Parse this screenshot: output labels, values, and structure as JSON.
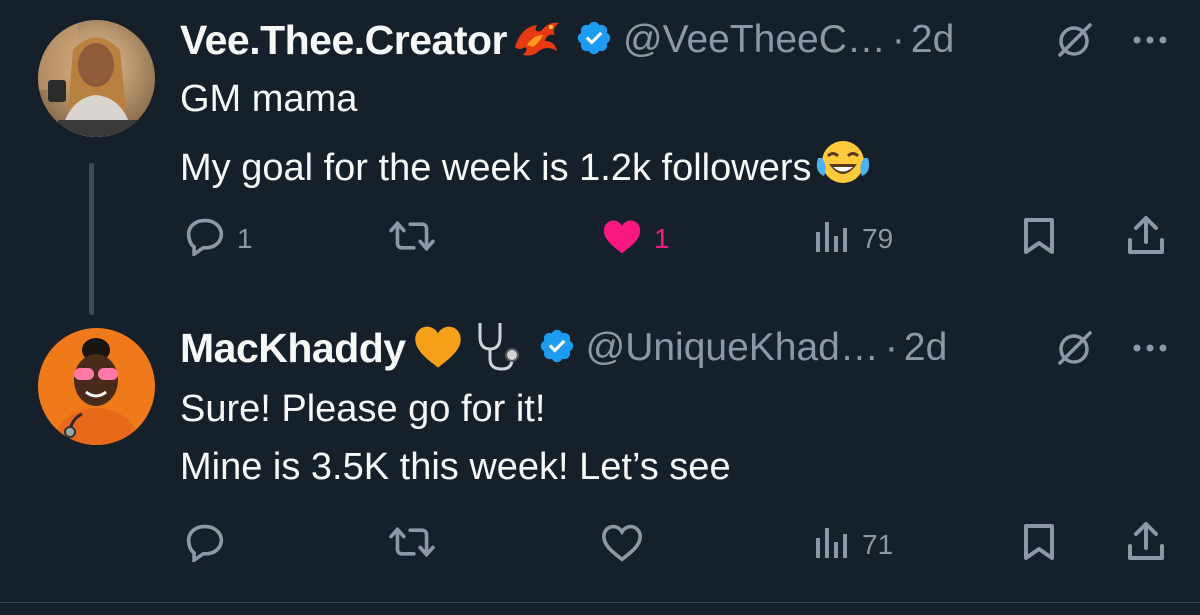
{
  "tweets": [
    {
      "name": "Vee.Thee.Creator",
      "handle": "@VeeTheeC…",
      "separator": "·",
      "time": "2d",
      "lines": [
        "GM mama",
        "My goal for the week is 1.2k followers"
      ],
      "name_emoji_icons": [
        "flame-bird-icon"
      ],
      "body_emoji_icon": "tears-of-joy-icon",
      "actions": {
        "reply_count": "1",
        "retweet_count": "",
        "like_count": "1",
        "liked": true,
        "views_count": "79"
      }
    },
    {
      "name": "MacKhaddy",
      "handle": "@UniqueKhad…",
      "separator": "·",
      "time": "2d",
      "lines": [
        "Sure! Please go for it!",
        "Mine is 3.5K this week! Let’s see"
      ],
      "name_emoji_icons": [
        "orange-heart-icon",
        "stethoscope-icon"
      ],
      "actions": {
        "reply_count": "",
        "retweet_count": "",
        "like_count": "",
        "liked": false,
        "views_count": "71"
      }
    }
  ],
  "colors": {
    "background": "#15202b",
    "text": "#f7f9f9",
    "muted": "#8b98a5",
    "verified": "#1d9bf0",
    "like": "#f91880",
    "thread_line": "#3f4a54"
  }
}
